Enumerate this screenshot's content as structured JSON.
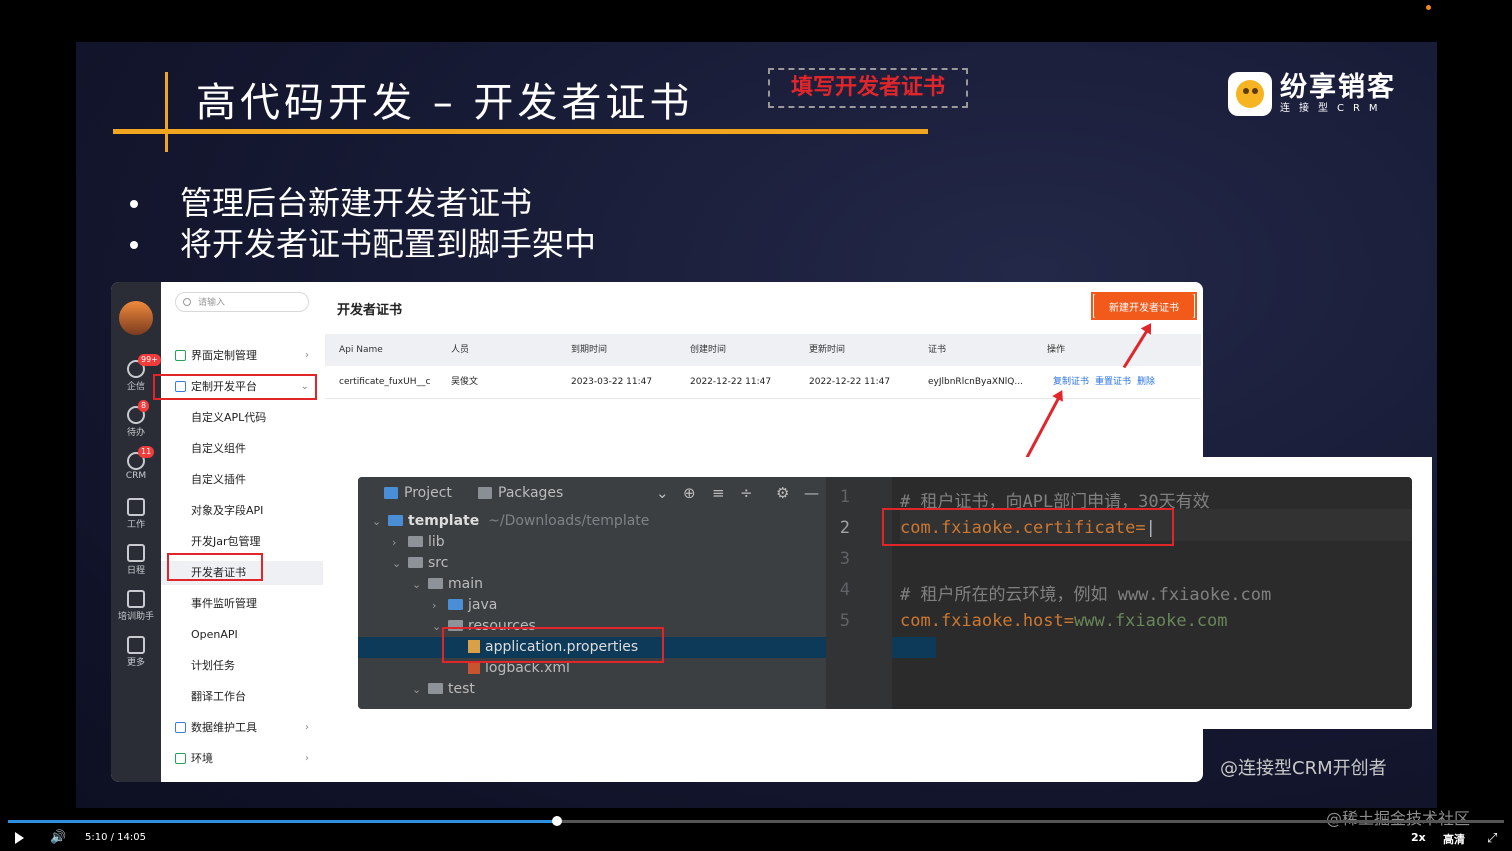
{
  "slide": {
    "title": "高代码开发 – 开发者证书",
    "logo_name": "纷享销客",
    "logo_sub": "连接型CRM",
    "bullets": [
      "管理后台新建开发者证书",
      "将开发者证书配置到脚手架中"
    ],
    "watermark": "@连接型CRM开创者"
  },
  "admin": {
    "search_placeholder": "请输入",
    "rail": [
      {
        "label": "企信",
        "badge": "99+"
      },
      {
        "label": "待办",
        "badge": "8"
      },
      {
        "label": "CRM",
        "badge": "11"
      },
      {
        "label": "工作",
        "badge": ""
      },
      {
        "label": "日程",
        "badge": ""
      },
      {
        "label": "培训助手",
        "badge": ""
      },
      {
        "label": "更多",
        "badge": ""
      }
    ],
    "menu": {
      "ui_mgmt": "界面定制管理",
      "dev_platform": "定制开发平台",
      "sub": [
        "自定义APL代码",
        "自定义组件",
        "自定义插件",
        "对象及字段API",
        "开发Jar包管理",
        "开发者证书",
        "事件监听管理",
        "OpenAPI",
        "计划任务",
        "翻译工作台"
      ],
      "data_tools": "数据维护工具",
      "env": "环境"
    },
    "content_title": "开发者证书",
    "new_button": "新建开发者证书",
    "columns": [
      "Api Name",
      "人员",
      "到期时间",
      "创建时间",
      "更新时间",
      "证书",
      "操作"
    ],
    "rows": [
      {
        "api_name": "certificate_fuxUH__c",
        "person": "吴俊文",
        "expire": "2023-03-22 11:47",
        "created": "2022-12-22 11:47",
        "updated": "2022-12-22 11:47",
        "cert": "eyJlbnRlcnByaXNlQ...",
        "actions": [
          "复制证书",
          "重置证书",
          "删除"
        ]
      }
    ]
  },
  "ide": {
    "tab_project": "Project",
    "tab_packages": "Packages",
    "tree": {
      "root": "template",
      "root_path": "~/Downloads/template",
      "lib": "lib",
      "src": "src",
      "main": "main",
      "java": "java",
      "resources": "resources",
      "app_props": "application.properties",
      "logback": "logback.xml",
      "test": "test"
    },
    "line_numbers": [
      "1",
      "2",
      "3",
      "4",
      "5"
    ],
    "code": {
      "line1": "# 租户证书，向APL部门申请，30天有效",
      "line2_key": "com.fxiaoke.certificate=",
      "line4": "# 租户所在的云环境，例如 www.fxiaoke.com",
      "line5_key": "com.fxiaoke.host=",
      "line5_val": "www.fxiaoke.com"
    },
    "hint": "填写开发者证书"
  },
  "player": {
    "time": "5:10 / 14:05",
    "progress": 0.367,
    "speed": "2x",
    "quality": "高清"
  },
  "site_watermark": "@稀土掘金技术社区",
  "colors": {
    "accent": "#f2a51e",
    "highlight": "#e0262b",
    "primary_btn": "#f25a1c",
    "link": "#2a73e6"
  }
}
